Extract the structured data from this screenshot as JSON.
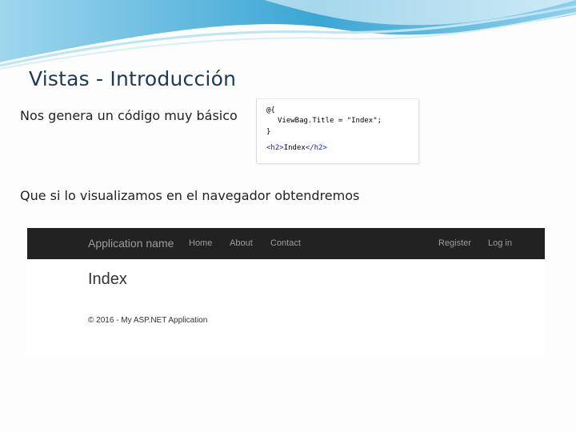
{
  "slide": {
    "title": "Vistas - Introducción",
    "text_1": "Nos genera un código muy básico",
    "text_2": "Que si lo visualizamos en el navegador obtendremos"
  },
  "code_snippet": {
    "line_1": "@{",
    "line_2": "ViewBag.Title = \"Index\";",
    "line_3": "}",
    "line_4_open_tag": "<h2>",
    "line_4_text": "Index",
    "line_4_close_tag": "</h2>"
  },
  "browser_preview": {
    "brand": "Application name",
    "nav_links": [
      "Home",
      "About",
      "Contact"
    ],
    "right_links": [
      "Register",
      "Log in"
    ],
    "page_heading": "Index",
    "footer": "© 2016 - My ASP.NET Application"
  },
  "colors": {
    "wave_primary": "#3fa9d6",
    "wave_light": "#a9dcf0",
    "navbar_bg": "#222222",
    "navbar_text": "#9d9d9d",
    "title_text": "#1d3a52"
  }
}
